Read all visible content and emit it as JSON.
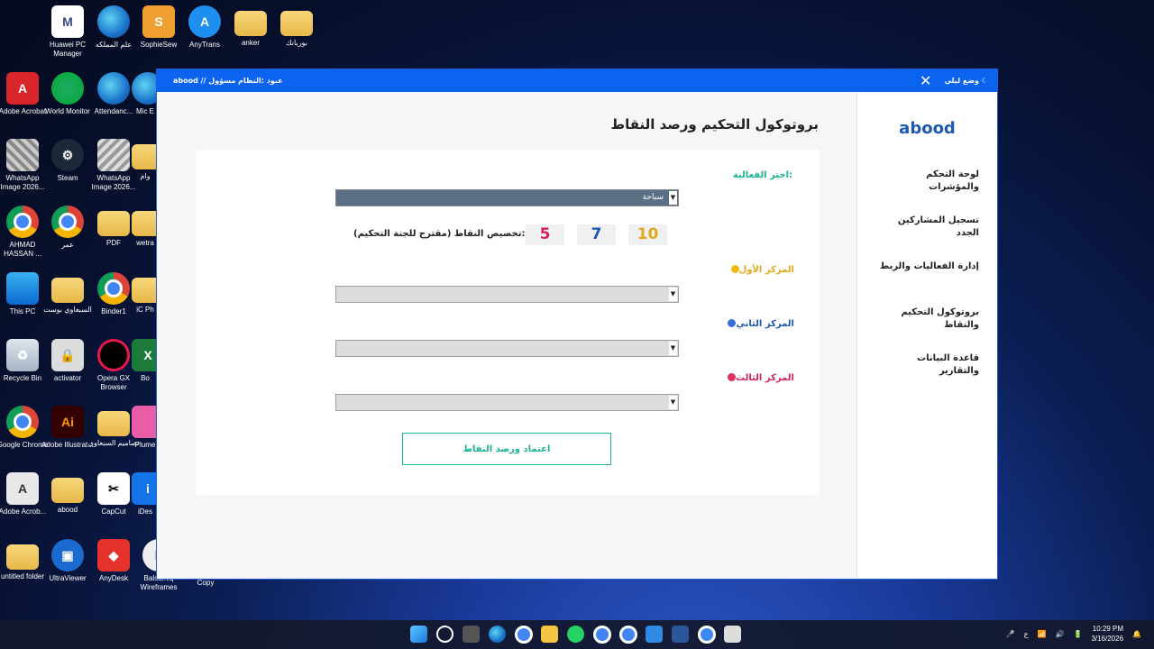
{
  "desktop": {
    "icons": [
      {
        "label": "Huawei PC Manager"
      },
      {
        "label": "علم المملكه"
      },
      {
        "label": "SophieSew"
      },
      {
        "label": "AnyTrans"
      },
      {
        "label": "anker"
      },
      {
        "label": "بوربانك"
      },
      {
        "label": "Adobe Acrobat"
      },
      {
        "label": "World Monitor"
      },
      {
        "label": "Attendanc..."
      },
      {
        "label": "Mic E"
      },
      {
        "label": "WhatsApp Image 2026..."
      },
      {
        "label": "Steam"
      },
      {
        "label": "WhatsApp Image 2026..."
      },
      {
        "label": "وام"
      },
      {
        "label": "AHMAD HASSAN ..."
      },
      {
        "label": "عمر"
      },
      {
        "label": "PDF"
      },
      {
        "label": "wetra"
      },
      {
        "label": "This PC"
      },
      {
        "label": "السبعاوي بوست"
      },
      {
        "label": "Binder1"
      },
      {
        "label": "iC Ph"
      },
      {
        "label": "Recycle Bin"
      },
      {
        "label": "activator"
      },
      {
        "label": "Opera GX Browser"
      },
      {
        "label": "Bo"
      },
      {
        "label": "Google Chrome"
      },
      {
        "label": "Adobe Illustrat..."
      },
      {
        "label": "تصاميم السبعاوي"
      },
      {
        "label": "Plume"
      },
      {
        "label": "Adobe Acrob..."
      },
      {
        "label": "abood"
      },
      {
        "label": "CapCut"
      },
      {
        "label": "iDes"
      },
      {
        "label": "untitled folder"
      },
      {
        "label": "UltraViewer"
      },
      {
        "label": "AnyDesk"
      },
      {
        "label": "Balsamiq Wireframes"
      },
      {
        "label": "Copy"
      }
    ]
  },
  "window": {
    "title": "abood // عبود :النظام مسؤول",
    "dark_mode": "وضع ليلي ☾",
    "close": "✕"
  },
  "sidebar": {
    "brand": "abood",
    "items": [
      {
        "label": "لوحة التحكم والمؤشرات"
      },
      {
        "label": "تسجيل المشاركين الجدد"
      },
      {
        "label": "إدارة الفعاليات والربط"
      },
      {
        "label": "بروتوكول التحكيم والنقاط"
      },
      {
        "label": "قاعدة البيانات والتقارير"
      }
    ]
  },
  "main": {
    "page_title": "بروتوكول التحكيم ورصد النقاط",
    "activity_label": ":اختر الفعالية",
    "activity_value": "سباحة",
    "points_label": ":تخصيص النقاط (مقترح للجنة التحكيم)",
    "points": [
      "5",
      "7",
      "10"
    ],
    "places": [
      {
        "label": "المركز الأول",
        "value": ""
      },
      {
        "label": "المركز الثاني",
        "value": ""
      },
      {
        "label": "المركز الثالث",
        "value": ""
      }
    ],
    "submit_label": "اعتماد ورصد النقاط",
    "colors": {
      "accent": "#19b394",
      "gold": "#e3a81b",
      "blue": "#1c58b3",
      "pink": "#d61f5a",
      "titlebar": "#0b63f0"
    }
  },
  "taskbar": {
    "time": "10:29 PM",
    "date": "3/16/2026",
    "lang": "ع"
  }
}
